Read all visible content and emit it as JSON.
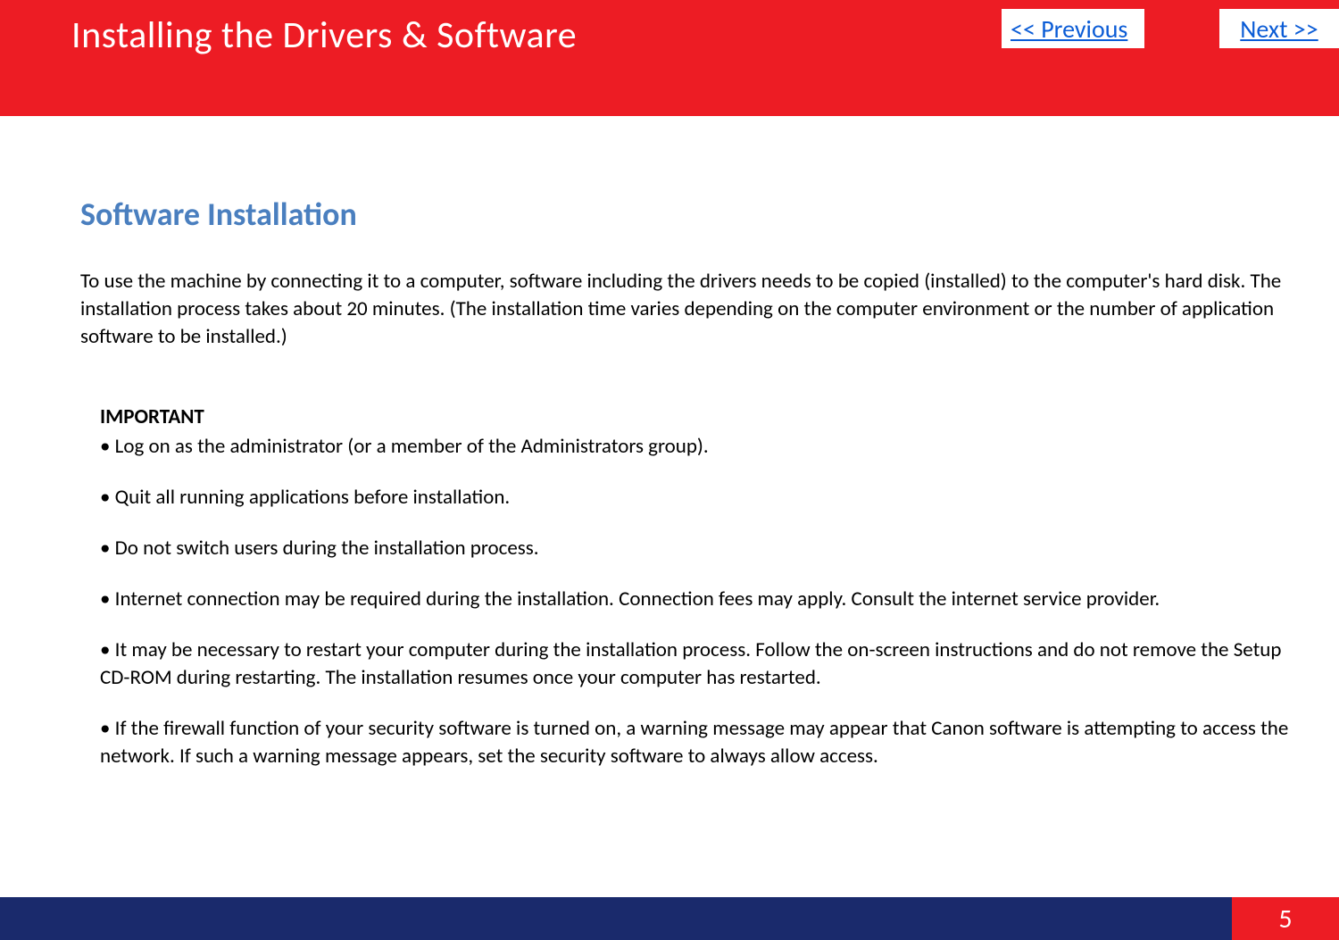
{
  "header": {
    "title": "Installing  the Drivers & Software",
    "prev_label": " << Previous",
    "next_label": "Next >>"
  },
  "section": {
    "heading": "Software Installation",
    "intro": "To use the machine by connecting it to a computer, software including the drivers needs to be copied (installed) to the computer's hard disk. The installation process takes about 20 minutes. (The installation time varies depending on the computer environment or the number of application software to be installed.)",
    "important_label": "IMPORTANT",
    "bullets": [
      "• Log on as the administrator (or a member of the Administrators group).",
      "• Quit all running applications before installation.",
      "• Do not switch users during the installation process.",
      "• Internet connection may be required during the installation. Connection fees may apply. Consult the internet service provider.",
      "• It may be necessary to restart your computer during the installation process. Follow the on-screen instructions and do not remove the Setup CD-ROM during restarting. The installation resumes once your computer has restarted.",
      "• If the firewall function of your security software is turned on, a warning message may appear that Canon software is attempting to access the network. If such a warning message appears, set the security software to always allow access."
    ]
  },
  "footer": {
    "page_number": "5"
  }
}
